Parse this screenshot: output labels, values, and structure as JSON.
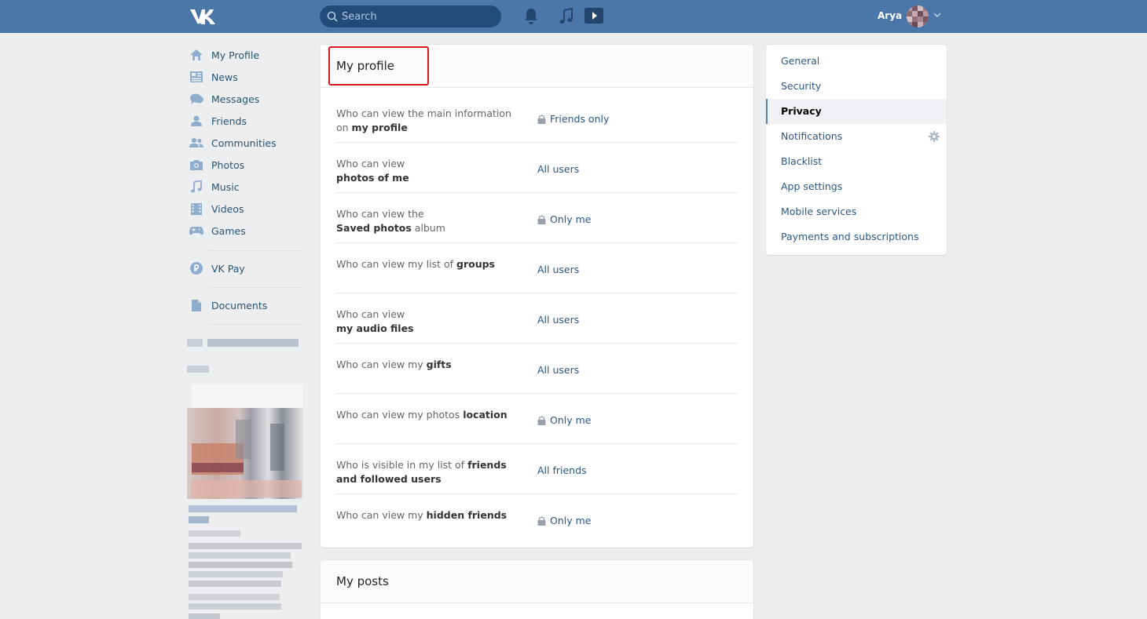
{
  "header": {
    "search_placeholder": "Search",
    "user_name": "Arya",
    "icons": [
      "vk-logo-icon",
      "search-icon",
      "bell-icon",
      "music-icon",
      "video-play-icon",
      "chevron-down-icon"
    ],
    "bg_color": "#4a76a8"
  },
  "leftnav": {
    "items": [
      {
        "label": "My Profile",
        "icon": "home-icon"
      },
      {
        "label": "News",
        "icon": "news-icon"
      },
      {
        "label": "Messages",
        "icon": "messages-icon"
      },
      {
        "label": "Friends",
        "icon": "friend-icon"
      },
      {
        "label": "Communities",
        "icon": "communities-icon"
      },
      {
        "label": "Photos",
        "icon": "camera-icon"
      },
      {
        "label": "Music",
        "icon": "music-icon"
      },
      {
        "label": "Videos",
        "icon": "film-icon"
      },
      {
        "label": "Games",
        "icon": "gamepad-icon"
      },
      {
        "label": "VK Pay",
        "icon": "vkpay-icon"
      },
      {
        "label": "Documents",
        "icon": "document-icon"
      }
    ]
  },
  "privacy": {
    "title": "My profile",
    "rows": [
      {
        "q_pre": "Who can view the main information on ",
        "q_bold": "my profile",
        "q_post": "",
        "value": "Friends only",
        "locked": true
      },
      {
        "q_pre": "Who can view ",
        "q_bold": "photos of me",
        "q_post": "",
        "value": "All users",
        "locked": false
      },
      {
        "q_pre": "Who can view the ",
        "q_bold": "Saved photos",
        "q_post": " album",
        "value": "Only me",
        "locked": true
      },
      {
        "q_pre": "Who can view my list of ",
        "q_bold": "groups",
        "q_post": "",
        "value": "All users",
        "locked": false
      },
      {
        "q_pre": "Who can view ",
        "q_bold": "my audio files",
        "q_post": "",
        "value": "All users",
        "locked": false
      },
      {
        "q_pre": "Who can view my ",
        "q_bold": "gifts",
        "q_post": "",
        "value": "All users",
        "locked": false
      },
      {
        "q_pre": "Who can view my photos ",
        "q_bold": "location",
        "q_post": "",
        "value": "Only me",
        "locked": true
      },
      {
        "q_pre": "Who is visible in my list of ",
        "q_bold": "friends and followed users",
        "q_post": "",
        "value": "All friends",
        "locked": false
      },
      {
        "q_pre": "Who can view my ",
        "q_bold": "hidden friends",
        "q_post": "",
        "value": "Only me",
        "locked": true
      }
    ]
  },
  "posts": {
    "title": "My posts"
  },
  "settings_menu": {
    "items": [
      "General",
      "Security",
      "Privacy",
      "Notifications",
      "Blacklist",
      "App settings",
      "Mobile services",
      "Payments and subscriptions"
    ],
    "active": "Privacy"
  }
}
